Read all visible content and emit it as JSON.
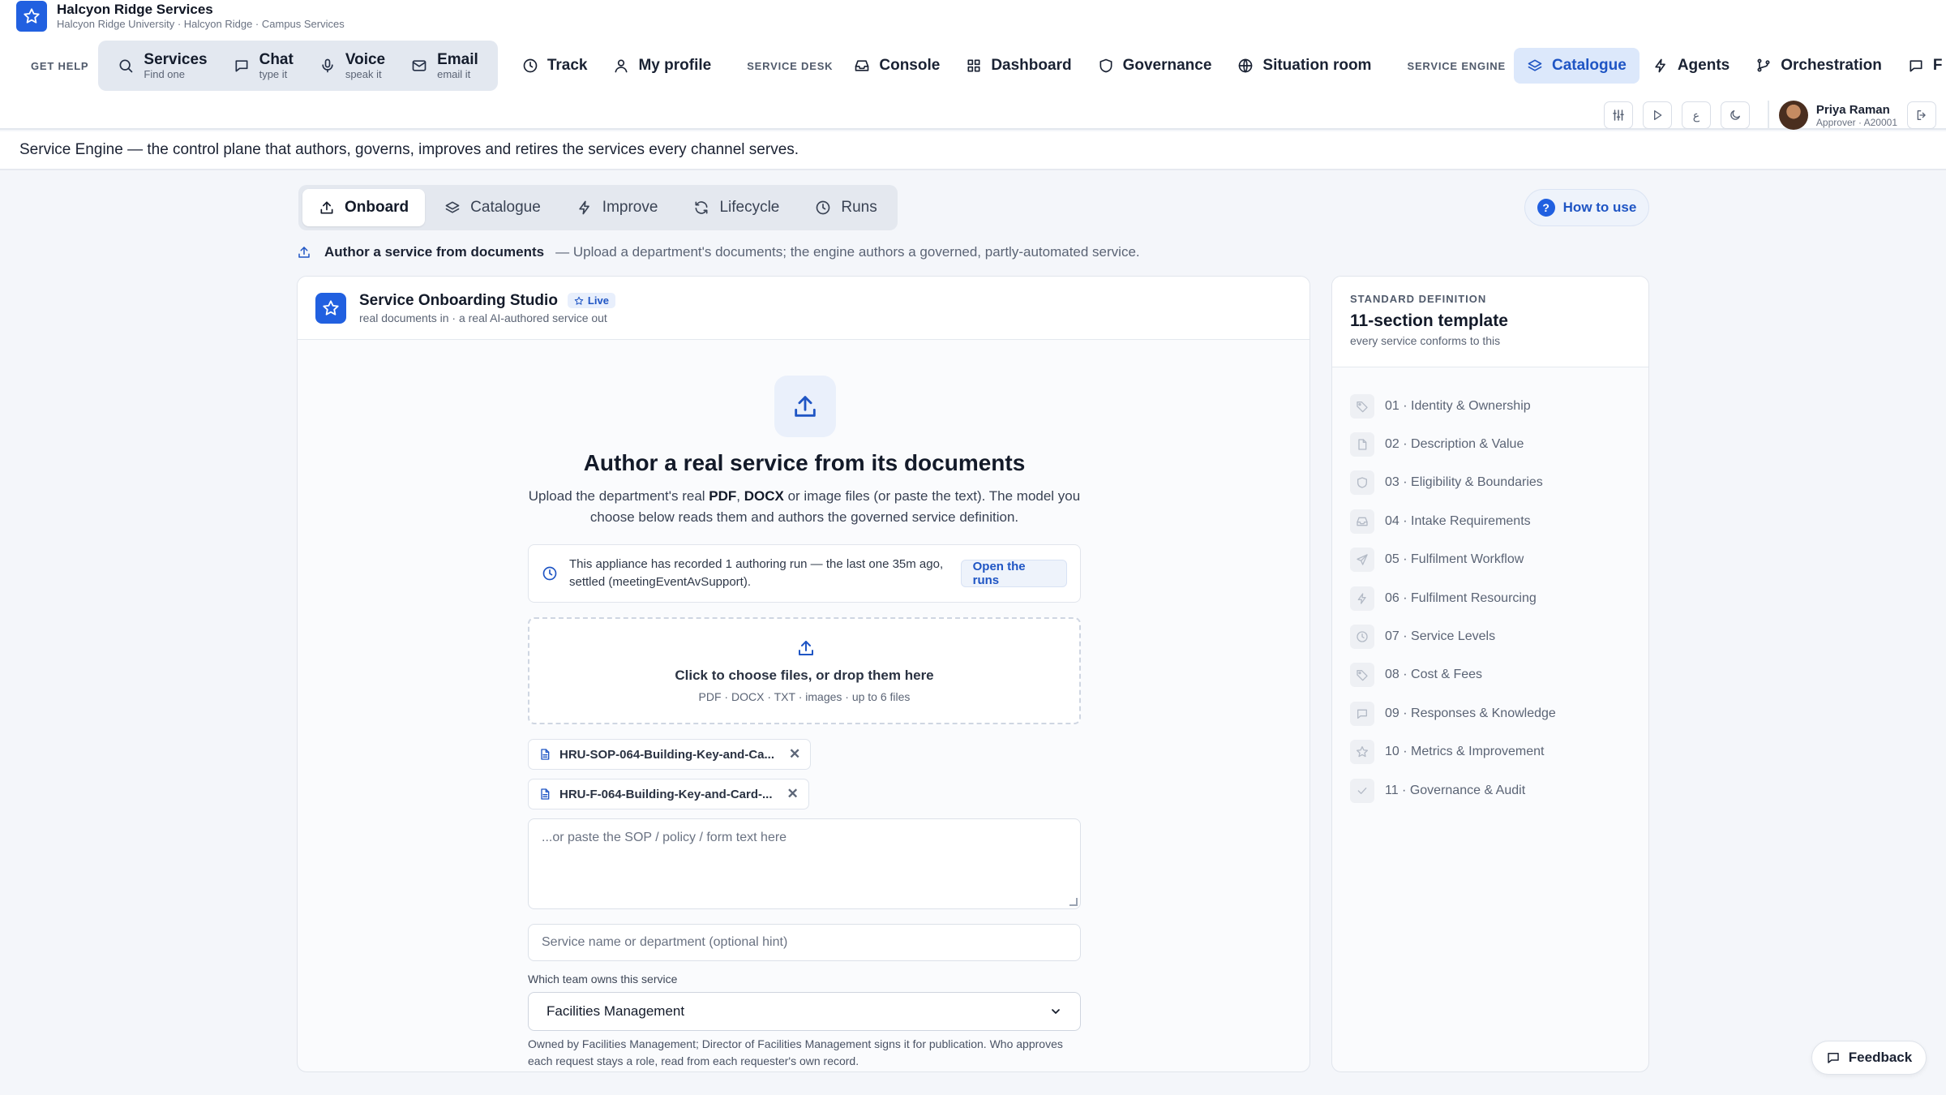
{
  "brand": {
    "title": "Halcyon Ridge Services",
    "subtitle": "Halcyon Ridge University · Halcyon Ridge · Campus Services"
  },
  "nav": {
    "get_help_label": "GET HELP",
    "help_items": [
      {
        "title": "Services",
        "sub": "Find one",
        "icon": "search-icon"
      },
      {
        "title": "Chat",
        "sub": "type it",
        "icon": "chat-icon"
      },
      {
        "title": "Voice",
        "sub": "speak it",
        "icon": "mic-icon"
      },
      {
        "title": "Email",
        "sub": "email it",
        "icon": "mail-icon"
      }
    ],
    "track": "Track",
    "my_profile": "My profile",
    "service_desk_label": "SERVICE DESK",
    "console": "Console",
    "dashboard": "Dashboard",
    "governance": "Governance",
    "situation_room": "Situation room",
    "service_engine_label": "SERVICE ENGINE",
    "catalogue": "Catalogue",
    "agents": "Agents",
    "orchestration": "Orchestration",
    "overflow": "F"
  },
  "toolbar": {
    "text_size_glyph": "ع"
  },
  "user": {
    "name": "Priya Raman",
    "role": "Approver · A20001"
  },
  "banner": "Service Engine — the control plane that authors, governs, improves and retires the services every channel serves.",
  "tabs": [
    "Onboard",
    "Catalogue",
    "Improve",
    "Lifecycle",
    "Runs"
  ],
  "how_to_use": "How to use",
  "subhead": {
    "title": "Author a service from documents",
    "desc": "— Upload a department's documents; the engine authors a governed, partly-automated service."
  },
  "studio": {
    "title": "Service Onboarding Studio",
    "badge": "Live",
    "subtitle": "real documents in · a real AI-authored service out",
    "hero_title": "Author a real service from its documents",
    "hero_desc_1": "Upload the department's real ",
    "hero_pdf": "PDF",
    "hero_sep": ", ",
    "hero_docx": "DOCX",
    "hero_desc_2": " or image files (or paste the text). The model you choose below reads them and authors the governed service definition.",
    "runs_text": "This appliance has recorded 1 authoring run — the last one 35m ago, settled (meetingEventAvSupport).",
    "open_runs": "Open the runs",
    "dropzone_title": "Click to choose files, or drop them here",
    "dropzone_sub": "PDF · DOCX · TXT · images · up to 6 files",
    "files": [
      "HRU-SOP-064-Building-Key-and-Ca...",
      "HRU-F-064-Building-Key-and-Card-..."
    ],
    "paste_placeholder": "...or paste the SOP / policy / form text here",
    "hint_placeholder": "Service name or department (optional hint)",
    "owner_label": "Which team owns this service",
    "owner_value": "Facilities Management",
    "owner_note": "Owned by Facilities Management; Director of Facilities Management signs it for publication. Who approves each request stays a role, read from each requester's own record."
  },
  "standard": {
    "label": "STANDARD DEFINITION",
    "title": "11-section template",
    "subtitle": "every service conforms to this",
    "sections": [
      {
        "label": "01 · Identity & Ownership",
        "icon": "tag-icon"
      },
      {
        "label": "02 · Description & Value",
        "icon": "document-icon"
      },
      {
        "label": "03 · Eligibility & Boundaries",
        "icon": "shield-icon"
      },
      {
        "label": "04 · Intake Requirements",
        "icon": "inbox-icon"
      },
      {
        "label": "05 · Fulfilment Workflow",
        "icon": "send-icon"
      },
      {
        "label": "06 · Fulfilment Resourcing",
        "icon": "bolt-icon"
      },
      {
        "label": "07 · Service Levels",
        "icon": "clock-icon"
      },
      {
        "label": "08 · Cost & Fees",
        "icon": "tag-icon"
      },
      {
        "label": "09 · Responses & Knowledge",
        "icon": "chat-icon"
      },
      {
        "label": "10 · Metrics & Improvement",
        "icon": "star-icon"
      },
      {
        "label": "11 · Governance & Audit",
        "icon": "check-icon"
      }
    ]
  },
  "feedback": "Feedback",
  "colors": {
    "accent": "#2160e0",
    "accent_text": "#1f55c4",
    "active_tab_bg": "#dce8fb"
  }
}
